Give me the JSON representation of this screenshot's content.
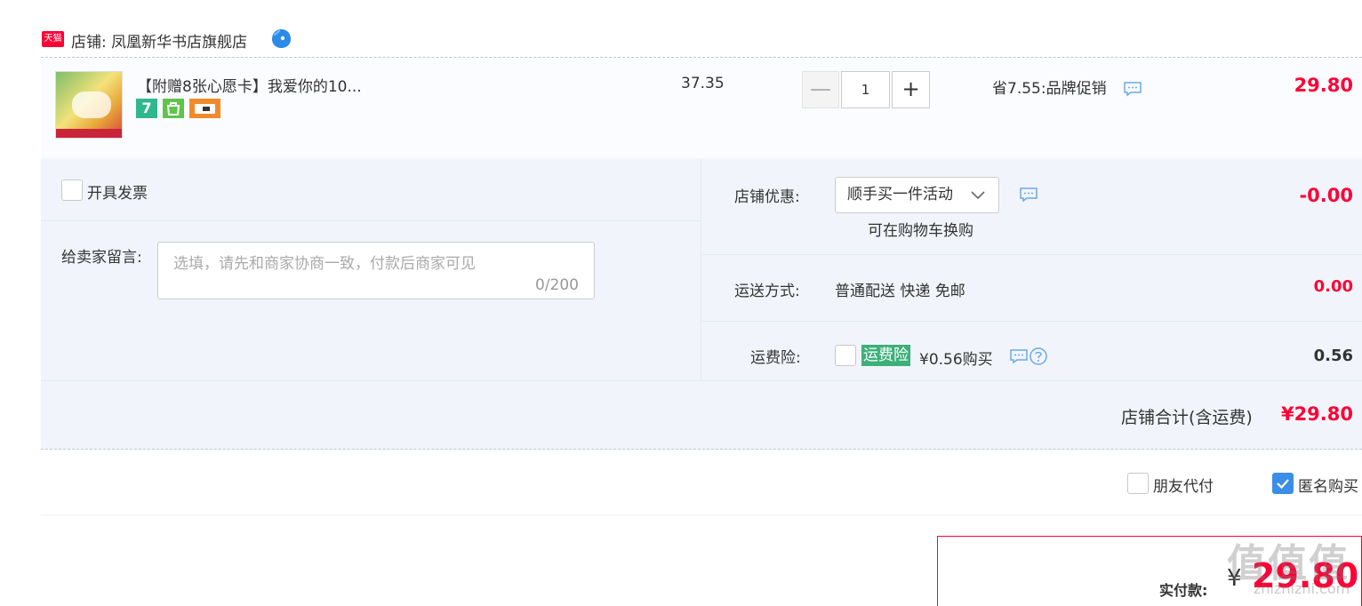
{
  "shop": {
    "logo_text": "天猫",
    "name": "店铺: 凤凰新华书店旗舰店"
  },
  "item": {
    "title": "【附赠8张心愿卡】我爱你的10...",
    "badge_seven": "7",
    "unit_price": "37.35",
    "quantity": "1",
    "minus_label": "—",
    "plus_label": "+",
    "promo": "省7.55:品牌促销",
    "total": "29.80"
  },
  "invoice": {
    "label": "开具发票"
  },
  "message": {
    "label": "给卖家留言:",
    "placeholder": "选填，请先和商家协商一致，付款后商家可见",
    "count": "0/200"
  },
  "shop_discount": {
    "label": "店铺优惠:",
    "selected": "顺手买一件活动",
    "hint": "可在购物车换购",
    "value": "-0.00"
  },
  "shipping": {
    "label": "运送方式:",
    "method": "普通配送 快递 免邮",
    "value": "0.00"
  },
  "insurance": {
    "label": "运费险:",
    "tag": "运费险",
    "price": "¥0.56购买",
    "value": "0.56"
  },
  "shop_total": {
    "label": "店铺合计(含运费)",
    "value": "¥29.80"
  },
  "options": {
    "friend_pay": "朋友代付",
    "anonymous": "匿名购买",
    "anonymous_checked": true
  },
  "payment": {
    "label": "实付款:",
    "currency": "¥",
    "amount": "29.80"
  },
  "watermark": {
    "main": "值值值",
    "sub": "zhizhizhi.com"
  },
  "colors": {
    "price_red": "#ff0036",
    "tag_green": "#3db07a",
    "check_blue": "#3a8ee6",
    "panel_bg": "#f1f5fb"
  }
}
